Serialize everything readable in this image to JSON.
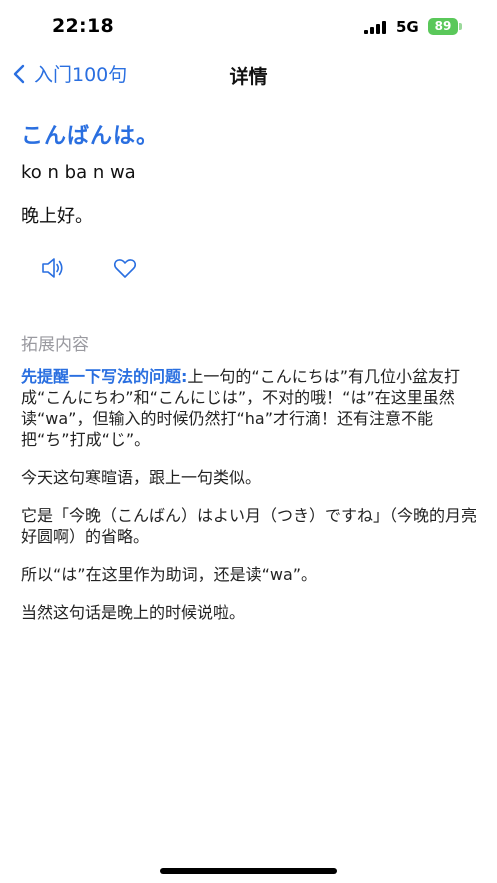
{
  "status": {
    "time": "22:18",
    "network": "5G",
    "battery": "89"
  },
  "nav": {
    "back_label": "入门100句",
    "title": "详情"
  },
  "phrase": {
    "japanese": "こんばんは。",
    "romaji": "ko n ba n wa",
    "meaning": "晚上好。"
  },
  "section_title": "拓展内容",
  "content": {
    "p1_highlight": "先提醒一下写法的问题:",
    "p1_text": "上一句的“こんにちは”有几位小盆友打成“こんにちわ”和“こんにじは”，不对的哦！“は”在这里虽然读“wa”，但输入的时候仍然打“ha”才行滴！还有注意不能把“ち”打成“じ”。",
    "p2": "今天这句寒暄语，跟上一句类似。",
    "p3": "它是「今晚（こんばん）はよい月（つき）ですね」（今晚的月亮好圆啊）的省略。",
    "p4": "所以“は”在这里作为助词，还是读“wa”。",
    "p5": "当然这句话是晚上的时候说啦。"
  },
  "colors": {
    "accent": "#2a6fe0",
    "muted": "#9a9aa0",
    "battery": "#5ac85a"
  },
  "icons": {
    "back": "chevron-left-icon",
    "speaker": "speaker-icon",
    "favorite": "heart-icon"
  }
}
